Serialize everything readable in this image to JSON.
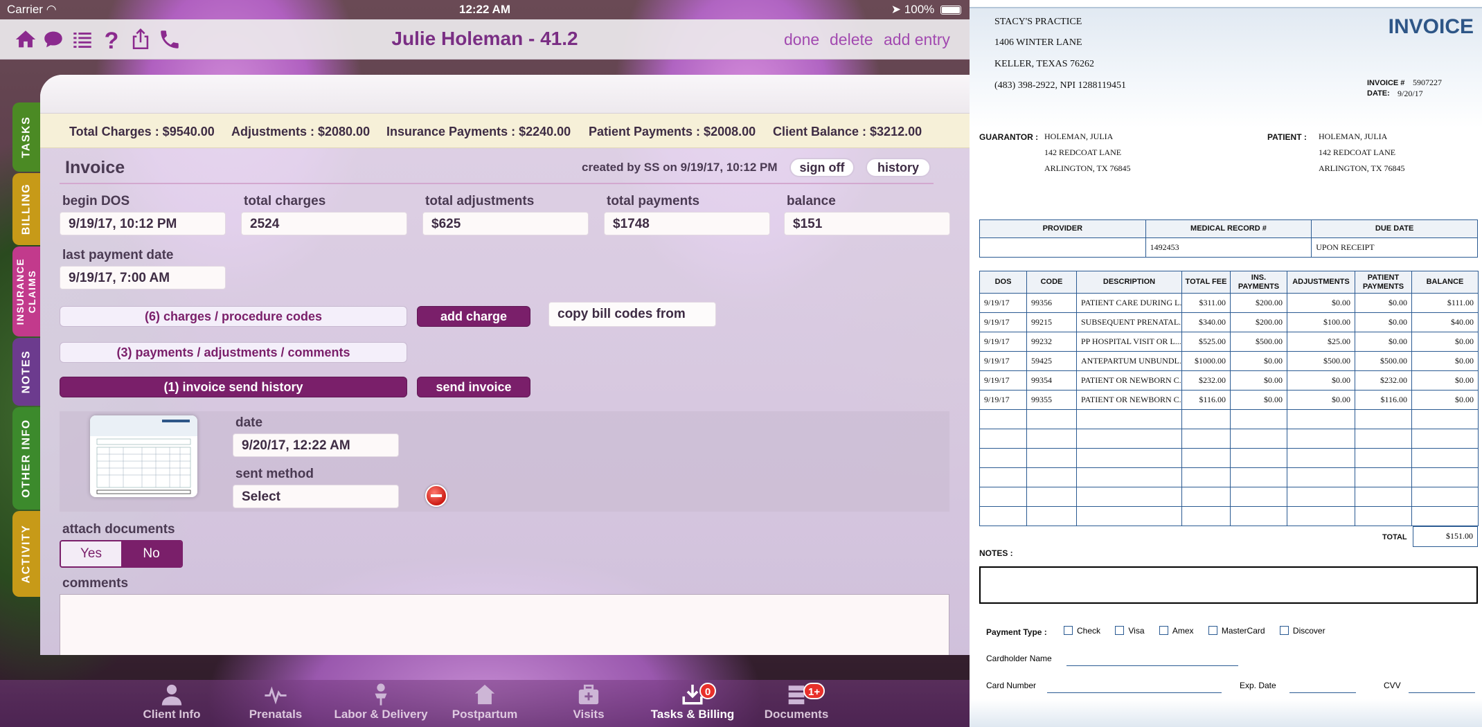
{
  "status": {
    "carrier": "Carrier",
    "time": "12:22 AM",
    "battery": "100%"
  },
  "nav": {
    "title": "Julie Holeman - 41.2",
    "done": "done",
    "delete": "delete",
    "add_entry": "add entry"
  },
  "side_tabs": [
    {
      "label": "TASKS",
      "color": "#4b8a24"
    },
    {
      "label": "BILLING",
      "color": "#c79a18"
    },
    {
      "label": "INSURANCE CLAIMS",
      "color": "#c23a8c"
    },
    {
      "label": "NOTES",
      "color": "#6c3b8e"
    },
    {
      "label": "OTHER INFO",
      "color": "#3c8a2c"
    },
    {
      "label": "ACTIVITY",
      "color": "#c79a18"
    }
  ],
  "summary": {
    "total_charges": "Total Charges : $9540.00",
    "adjustments": "Adjustments : $2080.00",
    "insurance_payments": "Insurance Payments : $2240.00",
    "patient_payments": "Patient Payments : $2008.00",
    "client_balance": "Client Balance : $3212.00"
  },
  "invoice": {
    "title": "Invoice",
    "created_by": "created by SS on 9/19/17, 10:12 PM",
    "sign_off": "sign off",
    "history": "history",
    "begin_dos_label": "begin DOS",
    "begin_dos": "9/19/17, 10:12 PM",
    "total_charges_label": "total charges",
    "total_charges": "2524",
    "total_adjustments_label": "total adjustments",
    "total_adjustments": "$625",
    "total_payments_label": "total payments",
    "total_payments": "$1748",
    "balance_label": "balance",
    "balance": "$151",
    "last_payment_label": "last payment date",
    "last_payment": "9/19/17, 7:00 AM",
    "charges_btn": "(6) charges / procedure codes",
    "add_charge": "add charge",
    "copy_bill_codes": "copy bill codes from",
    "payments_btn": "(3) payments / adjustments / comments",
    "send_history_btn": "(1) invoice send history",
    "send_invoice": "send invoice",
    "date_label": "date",
    "date": "9/20/17, 12:22 AM",
    "sent_method_label": "sent method",
    "sent_method": "Select",
    "attach_label": "attach documents",
    "yes": "Yes",
    "no": "No",
    "comments_label": "comments"
  },
  "tabbar": [
    {
      "label": "Client Info",
      "icon": "person-icon"
    },
    {
      "label": "Prenatals",
      "icon": "pulse-icon"
    },
    {
      "label": "Labor & Delivery",
      "icon": "baby-icon"
    },
    {
      "label": "Postpartum",
      "icon": "house-icon"
    },
    {
      "label": "Visits",
      "icon": "medkit-icon"
    },
    {
      "label": "Tasks & Billing",
      "icon": "download-icon",
      "badge": "0",
      "active": true
    },
    {
      "label": "Documents",
      "icon": "stack-icon",
      "badge": "1+"
    }
  ],
  "doc": {
    "practice": "STACY'S PRACTICE",
    "address1": "1406 WINTER LANE",
    "address2": "KELLER, TEXAS 76262",
    "phone_npi": "(483) 398-2922, NPI 1288119451",
    "title": "INVOICE",
    "invoice_no_label": "INVOICE #",
    "invoice_no": "5907227",
    "date_label": "DATE:",
    "date": "9/20/17",
    "guarantor_label": "GUARANTOR :",
    "guarantor": [
      "HOLEMAN, JULIA",
      "142 REDCOAT LANE",
      "ARLINGTON, TX 76845"
    ],
    "patient_label": "PATIENT :",
    "patient": [
      "HOLEMAN, JULIA",
      "142 REDCOAT LANE",
      "ARLINGTON, TX 76845"
    ],
    "info_headers": [
      "PROVIDER",
      "MEDICAL RECORD #",
      "DUE DATE"
    ],
    "info_values": [
      "",
      "1492453",
      "UPON RECEIPT"
    ],
    "line_headers": [
      "DOS",
      "CODE",
      "DESCRIPTION",
      "TOTAL FEE",
      "INS. PAYMENTS",
      "ADJUSTMENTS",
      "PATIENT PAYMENTS",
      "BALANCE"
    ],
    "lines": [
      [
        "9/19/17",
        "99356",
        "PATIENT CARE DURING L...",
        "$311.00",
        "$200.00",
        "$0.00",
        "$0.00",
        "$111.00"
      ],
      [
        "9/19/17",
        "99215",
        "SUBSEQUENT PRENATAL...",
        "$340.00",
        "$200.00",
        "$100.00",
        "$0.00",
        "$40.00"
      ],
      [
        "9/19/17",
        "99232",
        "PP HOSPITAL VISIT OR L...",
        "$525.00",
        "$500.00",
        "$25.00",
        "$0.00",
        "$0.00"
      ],
      [
        "9/19/17",
        "59425",
        "ANTEPARTUM UNBUNDL...",
        "$1000.00",
        "$0.00",
        "$500.00",
        "$500.00",
        "$0.00"
      ],
      [
        "9/19/17",
        "99354",
        "PATIENT OR NEWBORN C...",
        "$232.00",
        "$0.00",
        "$0.00",
        "$232.00",
        "$0.00"
      ],
      [
        "9/19/17",
        "99355",
        "PATIENT OR NEWBORN C...",
        "$116.00",
        "$0.00",
        "$0.00",
        "$116.00",
        "$0.00"
      ]
    ],
    "total_label": "TOTAL",
    "total": "$151.00",
    "notes_label": "NOTES :",
    "payment_type_label": "Payment Type :",
    "payment_types": [
      "Check",
      "Visa",
      "Amex",
      "MasterCard",
      "Discover"
    ],
    "cardholder_label": "Cardholder Name",
    "card_number_label": "Card Number",
    "exp_label": "Exp. Date",
    "cvv_label": "CVV"
  }
}
